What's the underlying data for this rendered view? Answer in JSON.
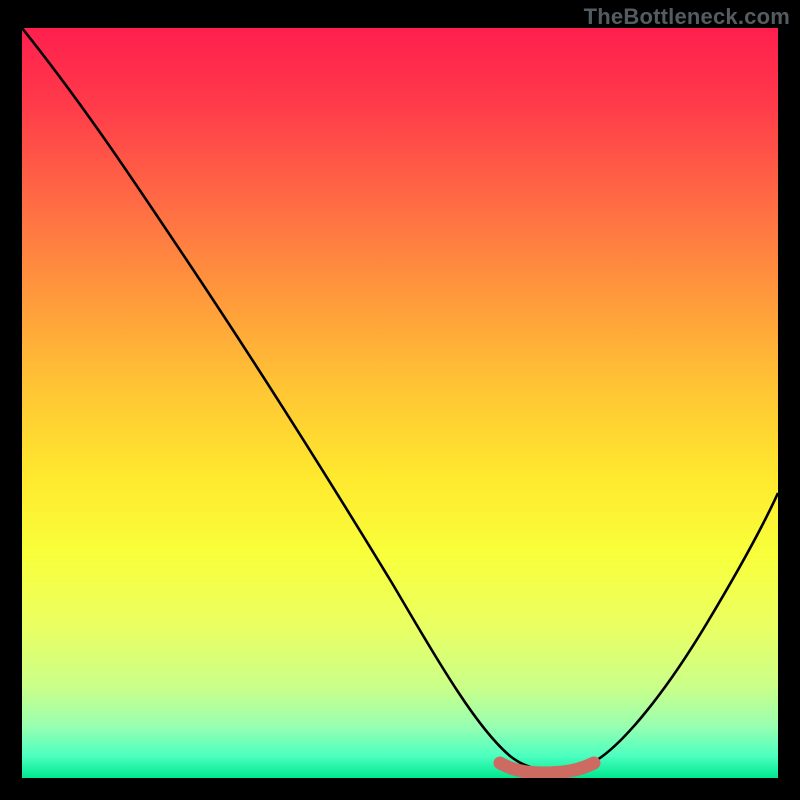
{
  "watermark": "TheBottleneck.com",
  "chart_data": {
    "type": "line",
    "title": "",
    "xlabel": "",
    "ylabel": "",
    "xlim": [
      0,
      100
    ],
    "ylim": [
      0,
      100
    ],
    "series": [
      {
        "name": "bottleneck-curve",
        "x": [
          0,
          8,
          15,
          22,
          30,
          38,
          45,
          52,
          58,
          63,
          66,
          70,
          74,
          78,
          82,
          88,
          94,
          100
        ],
        "values": [
          100,
          90,
          80,
          70,
          59,
          47,
          36,
          25,
          15,
          7,
          3,
          1,
          1,
          2,
          6,
          14,
          24,
          35
        ]
      }
    ],
    "highlight": {
      "name": "flat-minimum",
      "x_start": 63,
      "x_end": 76,
      "y": 1.5,
      "color": "#cd6a62"
    },
    "gradient_stops": [
      {
        "pos": 0.0,
        "color": "#ff1f4e"
      },
      {
        "pos": 0.5,
        "color": "#ffd430"
      },
      {
        "pos": 1.0,
        "color": "#00e88f"
      }
    ]
  }
}
